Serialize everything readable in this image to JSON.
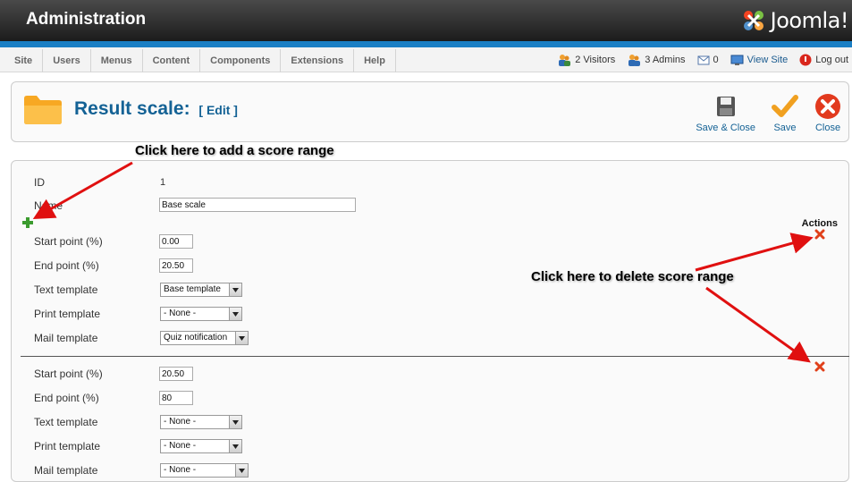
{
  "header": {
    "title": "Administration",
    "logo_text": "Joomla!"
  },
  "menu": {
    "items": [
      {
        "label": "Site"
      },
      {
        "label": "Users"
      },
      {
        "label": "Menus"
      },
      {
        "label": "Content"
      },
      {
        "label": "Components"
      },
      {
        "label": "Extensions"
      },
      {
        "label": "Help"
      }
    ]
  },
  "status": {
    "visitors": "2 Visitors",
    "admins": "3 Admins",
    "messages": "0",
    "view_site": "View Site",
    "logout": "Log out"
  },
  "toolbar": {
    "title": "Result scale:",
    "edit_tag": "[ Edit ]",
    "save_close_label": "Save & Close",
    "save_label": "Save",
    "close_label": "Close"
  },
  "form": {
    "id_label": "ID",
    "id_value": "1",
    "name_label": "Name",
    "name_value": "Base scale",
    "actions_label": "Actions",
    "ranges": [
      {
        "start_label": "Start point (%)",
        "start_value": "0.00",
        "end_label": "End point (%)",
        "end_value": "20.50",
        "text_label": "Text template",
        "text_value": "Base template",
        "print_label": "Print template",
        "print_value": "- None -",
        "mail_label": "Mail template",
        "mail_value": "Quiz notification"
      },
      {
        "start_label": "Start point (%)",
        "start_value": "20.50",
        "end_label": "End point (%)",
        "end_value": "80",
        "text_label": "Text template",
        "text_value": "- None -",
        "print_label": "Print template",
        "print_value": "- None -",
        "mail_label": "Mail template",
        "mail_value": "- None -"
      }
    ]
  },
  "annotations": {
    "add": "Click here to add a score range",
    "delete": "Click here to delete score range"
  },
  "colors": {
    "accent": "#1b7fc4",
    "title": "#146295",
    "arrow": "#e01010"
  }
}
